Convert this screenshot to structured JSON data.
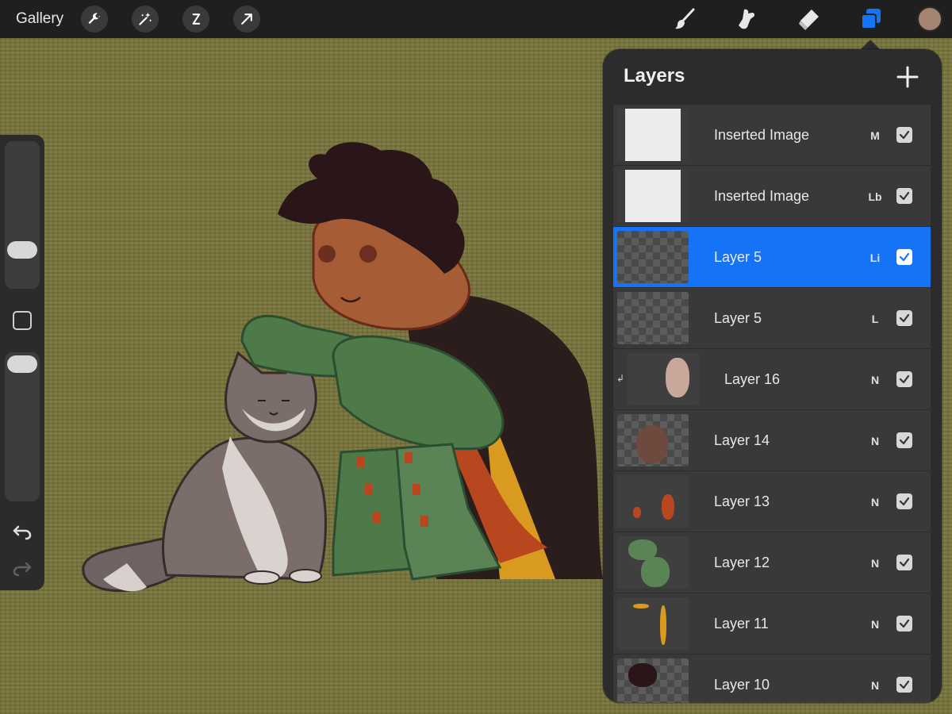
{
  "topbar": {
    "gallery_label": "Gallery",
    "left_tools": [
      "wrench-icon",
      "magic-wand-icon",
      "selection-icon",
      "transform-arrow-icon"
    ],
    "right_tools": [
      "brush-icon",
      "smudge-icon",
      "eraser-icon",
      "layers-icon"
    ],
    "active_tool": "layers-icon",
    "current_color": "#a58472"
  },
  "sidebar": {
    "brush_size_level": 0.75,
    "opacity_level": 0.05,
    "undo": "undo-icon",
    "redo": "redo-icon"
  },
  "layers_panel": {
    "title": "Layers",
    "add_button": "plus-icon",
    "layers": [
      {
        "name": "Inserted Image",
        "mode": "M",
        "visible": true,
        "active": false
      },
      {
        "name": "Inserted Image",
        "mode": "Lb",
        "visible": true,
        "active": false
      },
      {
        "name": "Layer 5",
        "mode": "Li",
        "visible": true,
        "active": true
      },
      {
        "name": "Layer 5",
        "mode": "L",
        "visible": true,
        "active": false
      },
      {
        "name": "Layer 16",
        "mode": "N",
        "visible": true,
        "active": false,
        "clipped": true
      },
      {
        "name": "Layer 14",
        "mode": "N",
        "visible": true,
        "active": false
      },
      {
        "name": "Layer 13",
        "mode": "N",
        "visible": true,
        "active": false
      },
      {
        "name": "Layer 12",
        "mode": "N",
        "visible": true,
        "active": false
      },
      {
        "name": "Layer 11",
        "mode": "N",
        "visible": true,
        "active": false
      },
      {
        "name": "Layer 10",
        "mode": "N",
        "visible": true,
        "active": false
      }
    ]
  },
  "colors": {
    "accent": "#1574f5",
    "canvas": "#77733a",
    "panel": "#2c2c2c"
  }
}
